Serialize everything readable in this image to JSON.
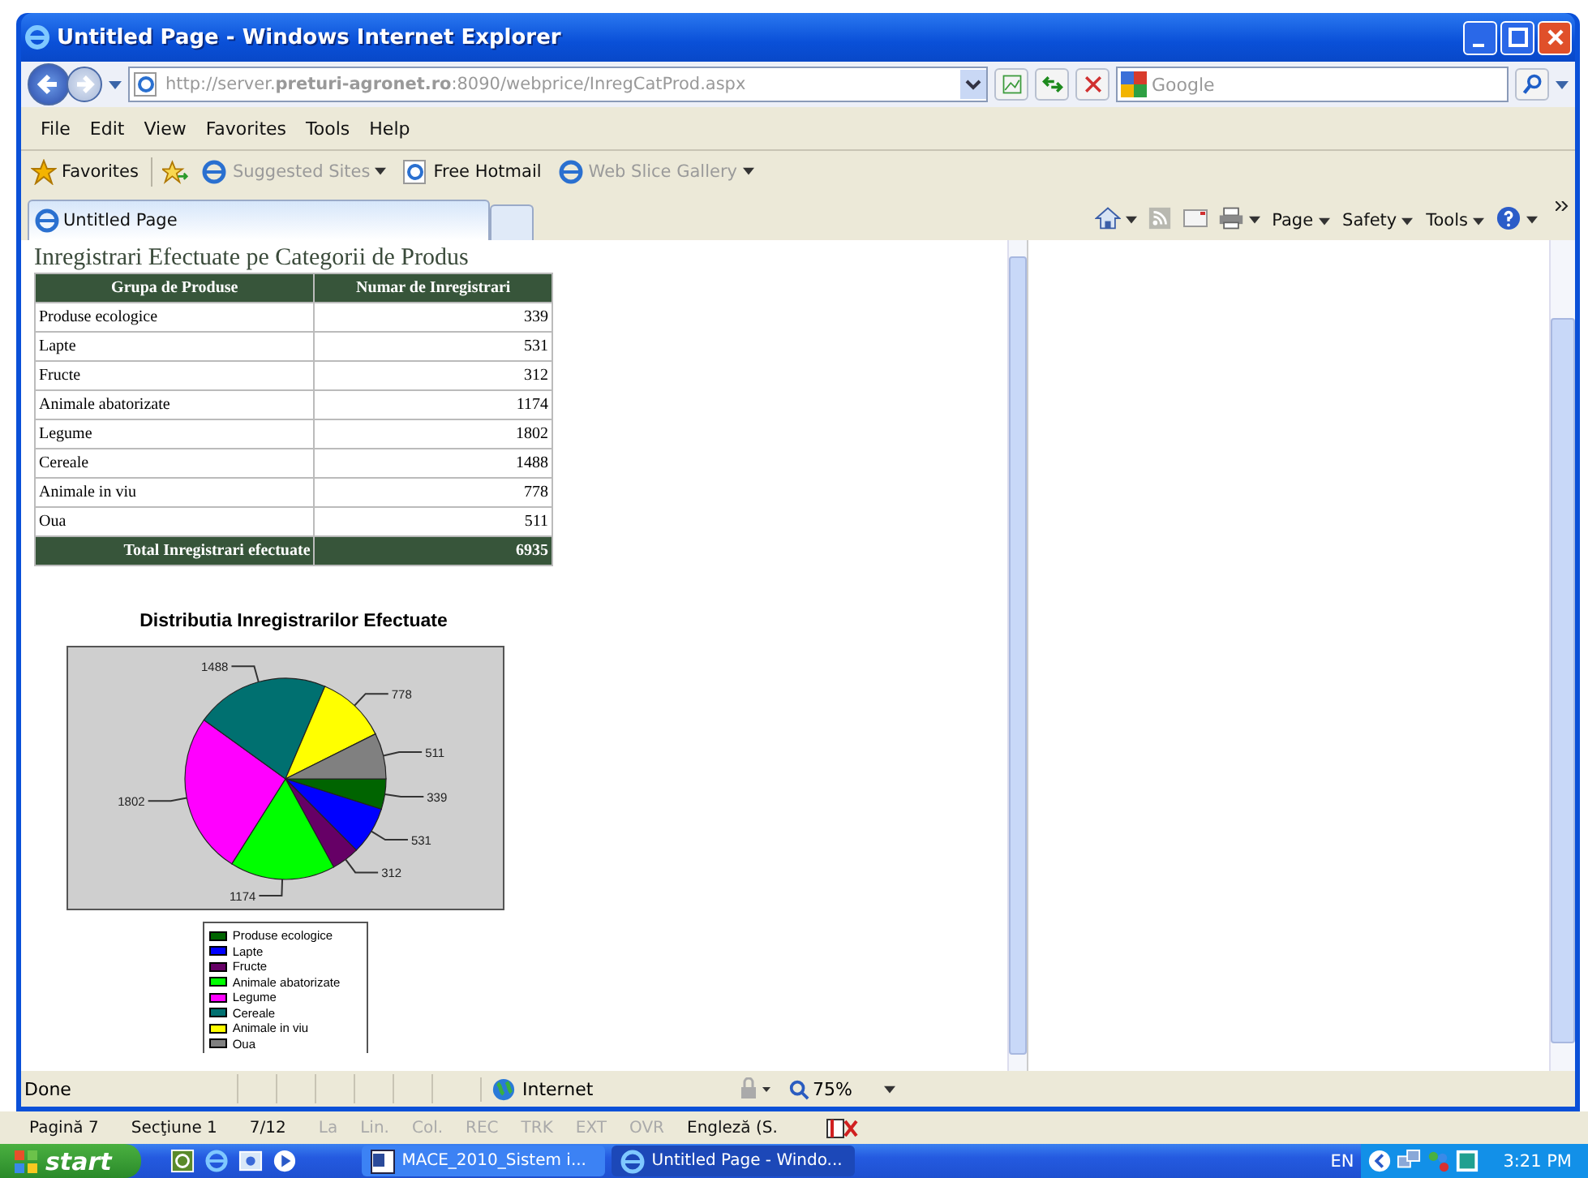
{
  "window": {
    "title": "Untitled Page - Windows Internet Explorer"
  },
  "address_bar": {
    "value": "http://server.**preturi-agronet.ro**:8090/webprice/InregCatProd.aspx"
  },
  "search": {
    "placeholder": "Google"
  },
  "menu": [
    "File",
    "Edit",
    "View",
    "Favorites",
    "Tools",
    "Help"
  ],
  "favorites_bar": [
    {
      "label": "Favorites",
      "kind": "star",
      "disabled": false
    },
    {
      "label": "Suggested Sites",
      "kind": "dropdown",
      "disabled": true
    },
    {
      "label": "Free Hotmail",
      "kind": "link",
      "disabled": false
    },
    {
      "label": "Web Slice Gallery",
      "kind": "dropdown",
      "disabled": true
    }
  ],
  "tabs": [
    {
      "label": "Untitled Page",
      "selected": true
    }
  ],
  "command_bar": [
    "Page",
    "Safety",
    "Tools"
  ],
  "page": {
    "heading": "Inregistrari Efectuate pe Categorii de Produs",
    "table": {
      "columns": [
        "Grupa de Produse",
        "Numar de Inregistrari"
      ],
      "rows": [
        [
          "Produse ecologice",
          "339"
        ],
        [
          "Lapte",
          "531"
        ],
        [
          "Fructe",
          "312"
        ],
        [
          "Animale abatorizate",
          "1174"
        ],
        [
          "Legume",
          "1802"
        ],
        [
          "Cereale",
          "1488"
        ],
        [
          "Animale in viu",
          "778"
        ],
        [
          "Oua",
          "511"
        ]
      ],
      "total": [
        "Total Inregistrari efectuate",
        "6935"
      ]
    },
    "chart_data": {
      "type": "pie",
      "title": "Distributia Inregistrarilor Efectuate",
      "data_labels": true,
      "categories": [
        "Produse ecologice",
        "Lapte",
        "Fructe",
        "Animale abatorizate",
        "Legume",
        "Cereale",
        "Animale in viu",
        "Oua"
      ],
      "values": [
        339,
        531,
        312,
        1174,
        1802,
        1488,
        778,
        511
      ],
      "legend": [
        {
          "color": "#006400"
        },
        {
          "color": "#0000ff"
        },
        {
          "color": "#660066"
        },
        {
          "color": "#00ff00"
        },
        {
          "color": "#ff00ff"
        },
        {
          "color": "#007070"
        },
        {
          "color": "#ffff00"
        },
        {
          "color": "#808080"
        }
      ]
    }
  },
  "status_bar": {
    "text": "Done",
    "zone": "Internet",
    "zoom": "75%"
  },
  "word_status": [
    {
      "text": "Pagină 7",
      "disabled": false
    },
    {
      "text": "Secţiune 1",
      "disabled": false
    },
    {
      "text": "7/12",
      "disabled": false
    },
    {
      "text": "La",
      "disabled": true
    },
    {
      "text": "Lin.",
      "disabled": true
    },
    {
      "text": "Col.",
      "disabled": true
    },
    {
      "text": "REC",
      "disabled": true
    },
    {
      "text": "TRK",
      "disabled": true
    },
    {
      "text": "EXT",
      "disabled": true
    },
    {
      "text": "OVR",
      "disabled": true
    },
    {
      "text": "Engleză (S.",
      "disabled": false
    }
  ],
  "taskbar": {
    "start": "start",
    "tasks": [
      {
        "label": "MACE_2010_Sistem i...",
        "selected": false,
        "kind": "document"
      },
      {
        "label": "Untitled Page - Windo...",
        "selected": true,
        "kind": "browser"
      }
    ],
    "language": "EN",
    "clock": "3:21 PM"
  }
}
